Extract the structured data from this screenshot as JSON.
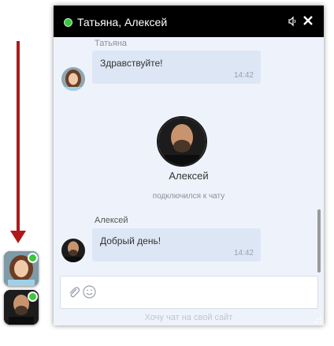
{
  "header": {
    "title": "Татьяна, Алексей",
    "icons": [
      "status-online",
      "sound-icon",
      "close-icon"
    ]
  },
  "messages": {
    "cut_sender": "Татьяна",
    "first": {
      "text": "Здравствуйте!",
      "time": "14:42"
    },
    "join": {
      "name": "Алексей",
      "text": "подключился к чату"
    },
    "second": {
      "sender": "Алексей",
      "text": "Добрый день!",
      "time": "14:42"
    }
  },
  "footer": {
    "link": "Хочу чат на свой сайт"
  },
  "colors": {
    "online": "#3bc83b",
    "arrow": "#b01919",
    "header_bg": "#000000",
    "bubble": "#dde6f4"
  }
}
